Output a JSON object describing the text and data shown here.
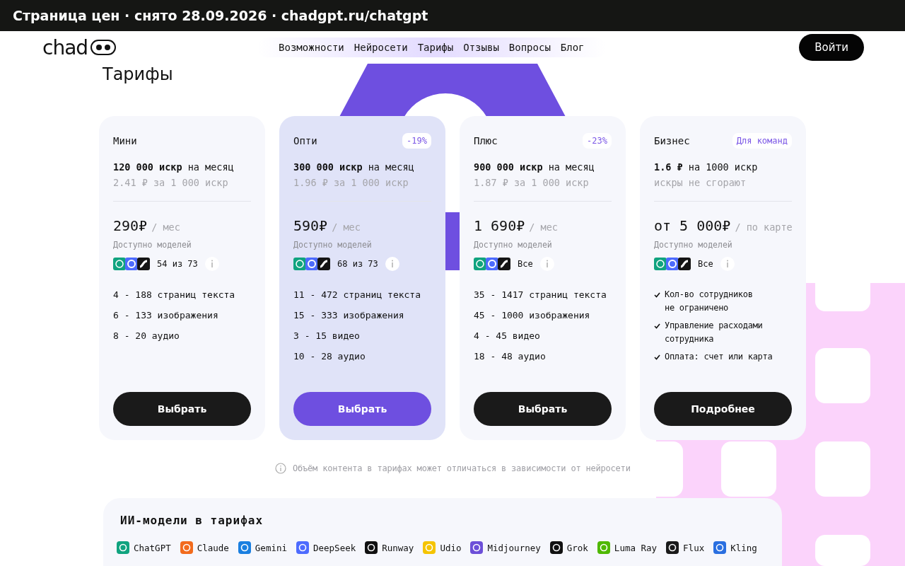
{
  "caption": "Страница цен · снято 28.09.2026 · chadgpt.ru/chatgpt",
  "header": {
    "logo": "chad",
    "nav": [
      {
        "label": "Возможности"
      },
      {
        "label": "Нейросети"
      },
      {
        "label": "Тарифы"
      },
      {
        "label": "Отзывы"
      },
      {
        "label": "Вопросы"
      },
      {
        "label": "Блог"
      }
    ],
    "login_button": "Войти"
  },
  "page_title": "Тарифы",
  "plans": [
    {
      "name": "Мини",
      "highlighted": false,
      "sparks": "**120 000 искр** на месяц",
      "rate": "2.41 ₽ за 1 000 искр",
      "price": "290₽",
      "period": "/ мес",
      "models_label": "Доступно моделей",
      "models_count": "54 из 73",
      "kind": "plain",
      "features": [
        "4 - 188 страниц текста",
        "6 - 133 изображения",
        "8 - 20 аудио"
      ],
      "button": "Выбрать"
    },
    {
      "name": "Опти",
      "badge": "-19%",
      "highlighted": true,
      "sparks": "**300 000 искр** на месяц",
      "rate": "1.96 ₽ за 1 000 искр",
      "price": "590₽",
      "period": "/ мес",
      "models_label": "Доступно моделей",
      "models_count": "68 из 73",
      "kind": "plain",
      "features": [
        "11 - 472 страниц текста",
        "15 - 333 изображения",
        "3 - 15 видео",
        "10 - 28 аудио"
      ],
      "button": "Выбрать"
    },
    {
      "name": "Плюс",
      "badge": "-23%",
      "highlighted": false,
      "sparks": "**900 000 искр** на месяц",
      "rate": "1.87 ₽ за 1 000 искр",
      "price": "1 690₽",
      "period": "/ мес",
      "models_label": "Доступно моделей",
      "models_count": "Все",
      "kind": "plain",
      "features": [
        "35 - 1417 страниц текста",
        "45 - 1000 изображения",
        "4 - 45 видео",
        "18 - 48 аудио"
      ],
      "button": "Выбрать"
    },
    {
      "name": "Бизнес",
      "badge": "Для команд",
      "highlighted": false,
      "sparks": "**1.6 ₽** на 1000 искр",
      "rate": "искры не сгорают",
      "price": "от 5 000₽",
      "period": "/ по карте",
      "models_label": "Доступно моделей",
      "models_count": "Все",
      "kind": "checks",
      "features": [
        "Кол-во сотрудников\nне ограничено",
        "Управление расходами\nсотрудника",
        "Оплата: счет или карта"
      ],
      "button": "Подробнее"
    }
  ],
  "note": "Объём контента в тарифах может отличаться в зависимости от нейросети",
  "models": {
    "title": "ИИ-модели в тарифах",
    "items": [
      {
        "name": "ChatGPT",
        "color": "#10a37f"
      },
      {
        "name": "Claude",
        "color": "#f26b1d"
      },
      {
        "name": "Gemini",
        "color": "#1a7fe0"
      },
      {
        "name": "DeepSeek",
        "color": "#4d6bfe"
      },
      {
        "name": "Runway",
        "color": "#111111"
      },
      {
        "name": "Udio",
        "color": "#f5c400"
      },
      {
        "name": "Midjourney",
        "color": "#6c4fd8"
      },
      {
        "name": "Grok",
        "color": "#111111"
      },
      {
        "name": "Luma Ray",
        "color": "#4fb800"
      },
      {
        "name": "Flux",
        "color": "#1a1a1a"
      },
      {
        "name": "Kling",
        "color": "#2a6fe0"
      }
    ]
  }
}
